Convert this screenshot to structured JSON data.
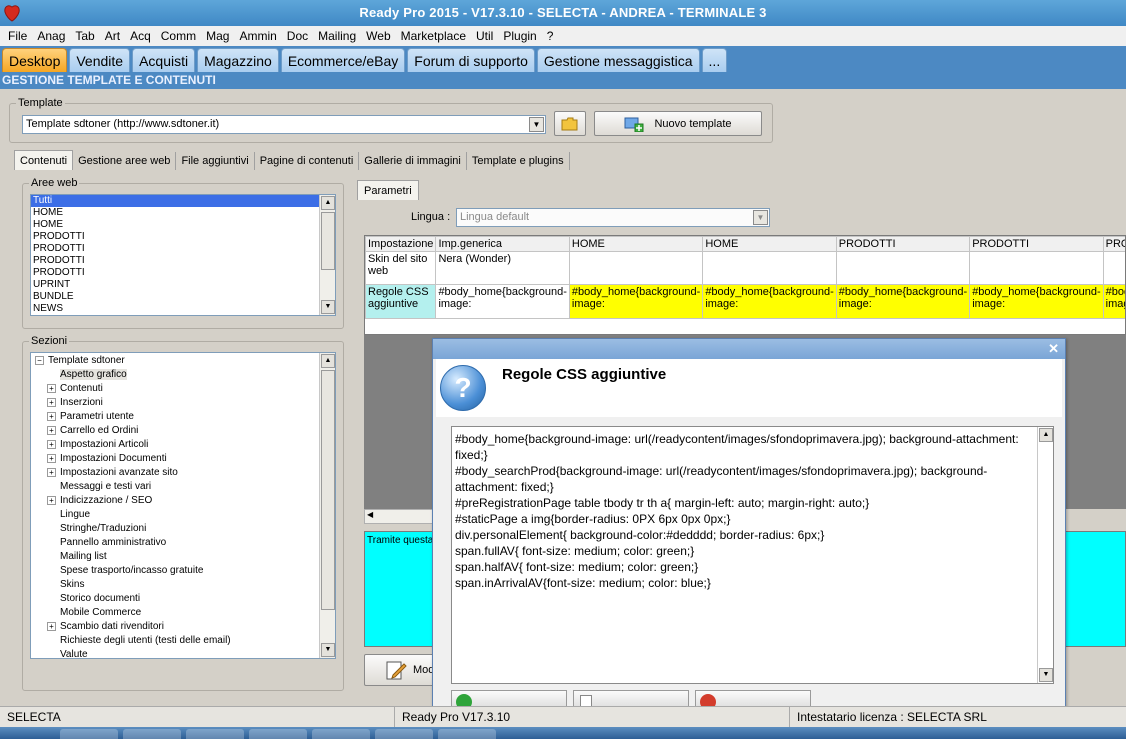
{
  "window": {
    "title": "Ready Pro 2015 - V17.3.10 - SELECTA - ANDREA - TERMINALE 3"
  },
  "menu": [
    "File",
    "Anag",
    "Tab",
    "Art",
    "Acq",
    "Comm",
    "Mag",
    "Ammin",
    "Doc",
    "Mailing",
    "Web",
    "Marketplace",
    "Util",
    "Plugin",
    "?"
  ],
  "main_tabs": [
    "Desktop",
    "Vendite",
    "Acquisti",
    "Magazzino",
    "Ecommerce/eBay",
    "Forum di supporto",
    "Gestione messaggistica",
    "..."
  ],
  "section_title": "GESTIONE TEMPLATE E CONTENUTI",
  "template": {
    "label": "Template",
    "selected": "Template sdtoner (http://www.sdtoner.it)",
    "new_button": "Nuovo template"
  },
  "sub_tabs": [
    "Contenuti",
    "Gestione aree web",
    "File aggiuntivi",
    "Pagine di contenuti",
    "Gallerie di immagini",
    "Template e plugins"
  ],
  "web_areas": {
    "label": "Aree web",
    "items": [
      "Tutti",
      "HOME",
      "HOME",
      "PRODOTTI",
      "PRODOTTI",
      "PRODOTTI",
      "PRODOTTI",
      "UPRINT",
      "BUNDLE",
      "NEWS"
    ]
  },
  "sections": {
    "label": "Sezioni",
    "root": "Template sdtoner",
    "nodes": [
      {
        "label": "Aspetto grafico",
        "expandable": false,
        "highlight": true
      },
      {
        "label": "Contenuti",
        "expandable": true
      },
      {
        "label": "Inserzioni",
        "expandable": true
      },
      {
        "label": "Parametri utente",
        "expandable": true
      },
      {
        "label": "Carrello ed Ordini",
        "expandable": true
      },
      {
        "label": "Impostazioni Articoli",
        "expandable": true
      },
      {
        "label": "Impostazioni Documenti",
        "expandable": true
      },
      {
        "label": "Impostazioni avanzate sito",
        "expandable": true
      },
      {
        "label": "Messaggi e testi vari",
        "expandable": false
      },
      {
        "label": "Indicizzazione / SEO",
        "expandable": true
      },
      {
        "label": "Lingue",
        "expandable": false
      },
      {
        "label": "Stringhe/Traduzioni",
        "expandable": false
      },
      {
        "label": "Pannello amministrativo",
        "expandable": false
      },
      {
        "label": "Mailing list",
        "expandable": false
      },
      {
        "label": "Spese trasporto/incasso gratuite",
        "expandable": false
      },
      {
        "label": "Skins",
        "expandable": false
      },
      {
        "label": "Storico documenti",
        "expandable": false
      },
      {
        "label": "Mobile Commerce",
        "expandable": false
      },
      {
        "label": "Scambio dati rivenditori",
        "expandable": true
      },
      {
        "label": "Richieste degli utenti (testi delle email)",
        "expandable": false
      },
      {
        "label": "Valute",
        "expandable": false
      }
    ]
  },
  "params": {
    "tab": "Parametri",
    "language_label": "Lingua :",
    "language_value": "Lingua default",
    "columns": [
      "Impostazione",
      "Imp.generica",
      "HOME",
      "HOME",
      "PRODOTTI",
      "PRODOTTI",
      "PRODOTTI",
      "P"
    ],
    "row1": {
      "name": "Skin del sito web",
      "generic": "Nera (Wonder)"
    },
    "row2": {
      "name": "Regole CSS aggiuntive",
      "generic": "#body_home{background-image:",
      "value": "#body_home{background-image:"
    },
    "info_text": "Tramite questa",
    "modify_button": "Mod"
  },
  "dialog": {
    "title": "Regole CSS aggiuntive",
    "icon": "question-icon",
    "css_text": "#body_home{background-image: url(/readycontent/images/sfondoprimavera.jpg); background-attachment: fixed;}\n#body_searchProd{background-image: url(/readycontent/images/sfondoprimavera.jpg); background-attachment: fixed;}\n#preRegistrationPage table tbody tr th a{ margin-left: auto; margin-right: auto;}\n#staticPage a img{border-radius: 0PX 6px 0px 0px;}\ndiv.personalElement{ background-color:#dedddd; border-radius: 6px;}\nspan.fullAV{ font-size: medium; color: green;}\nspan.halfAV{ font-size: medium; color: green;}\nspan.inArrivalAV{font-size: medium; color: blue;}"
  },
  "status": {
    "company": "SELECTA",
    "version": "Ready Pro V17.3.10",
    "license": "Intestatario licenza : SELECTA SRL"
  }
}
